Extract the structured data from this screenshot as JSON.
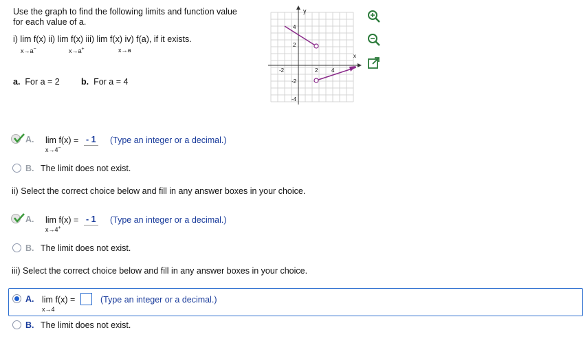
{
  "question": {
    "line1": "Use the graph to find the following limits and function value",
    "line2": "for each value of a.",
    "parts_line": "i)  lim  f(x)  ii)  lim  f(x)  iii)  lim  f(x)  iv)  f(a), if it exists.",
    "sub1": "x→a",
    "sub1_sup": "−",
    "sub2": "x→a",
    "sub2_sup": "+",
    "sub3": "x→a",
    "case_a_letter": "a.",
    "case_a_text": "For a = 2",
    "case_b_letter": "b.",
    "case_b_text": "For a = 4"
  },
  "graph": {
    "x_axis_label": "x",
    "y_axis_label": "y",
    "tick_labels": [
      "4",
      "2",
      "-2",
      "2",
      "4",
      "-2",
      "-4"
    ],
    "line_color": "#8a2a8a"
  },
  "part_i": {
    "choice_a_letter": "A.",
    "lim_text": "lim  f(x) =",
    "lim_sub": "x→4",
    "lim_sub_sup": "−",
    "answer": "- 1",
    "hint": "(Type an integer or a decimal.)",
    "choice_b_letter": "B.",
    "choice_b_text": "The limit does not exist."
  },
  "part_ii": {
    "prompt": "ii) Select the correct choice below and fill in any answer boxes in your choice.",
    "choice_a_letter": "A.",
    "lim_text": "lim  f(x) =",
    "lim_sub": "x→4",
    "lim_sub_sup": "+",
    "answer": "- 1",
    "hint": "(Type an integer or a decimal.)",
    "choice_b_letter": "B.",
    "choice_b_text": "The limit does not exist."
  },
  "part_iii": {
    "prompt": "iii) Select the correct choice below and fill in any answer boxes in your choice.",
    "choice_a_letter": "A.",
    "lim_text": "lim  f(x) =",
    "lim_sub": "x→4",
    "answer": "",
    "hint": "(Type an integer or a decimal.)",
    "choice_b_letter": "B.",
    "choice_b_text": "The limit does not exist."
  },
  "icons": {
    "zoom_in": "zoom-in-icon",
    "zoom_out": "zoom-out-icon",
    "popout": "popout-icon",
    "check": "correct-check-icon",
    "accent": "#2d6fd0"
  }
}
